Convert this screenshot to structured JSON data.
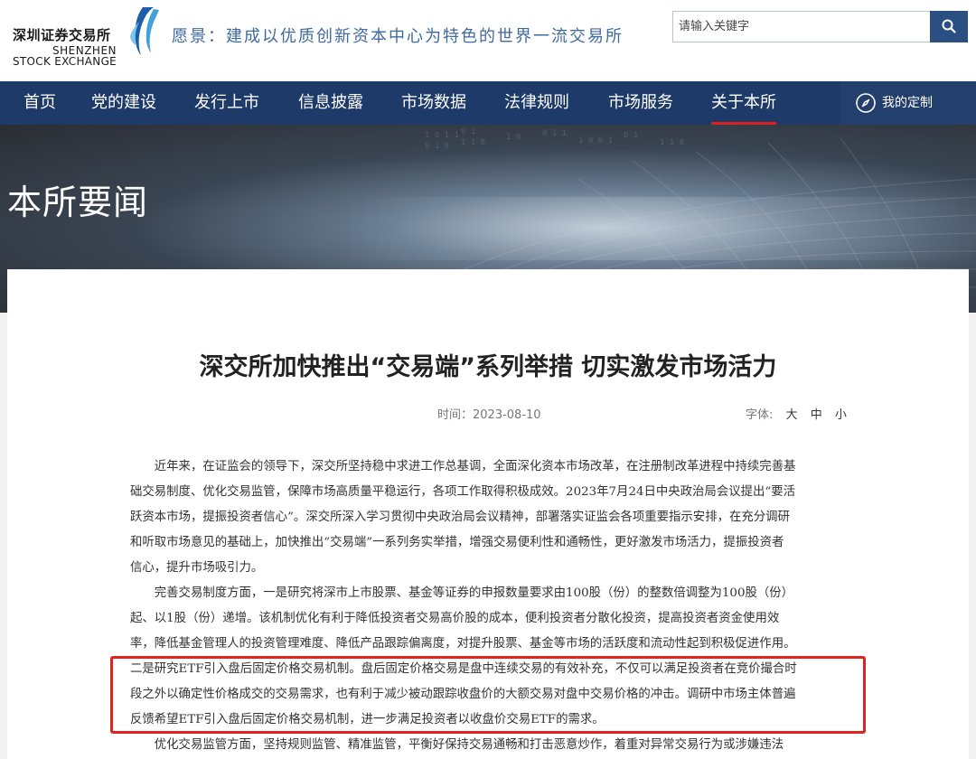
{
  "header": {
    "logo": {
      "name_cn": "深圳证券交易所",
      "name_en_line1": "SHENZHEN",
      "name_en_line2": "STOCK EXCHANGE"
    },
    "vision": "愿景：建成以优质创新资本中心为特色的世界一流交易所",
    "search": {
      "placeholder": "请输入关键字",
      "icon": "search-icon"
    }
  },
  "nav": {
    "items": [
      {
        "label": "首页",
        "active": false
      },
      {
        "label": "党的建设",
        "active": false
      },
      {
        "label": "发行上市",
        "active": false
      },
      {
        "label": "信息披露",
        "active": false
      },
      {
        "label": "市场数据",
        "active": false
      },
      {
        "label": "法律规则",
        "active": false
      },
      {
        "label": "市场服务",
        "active": false
      },
      {
        "label": "关于本所",
        "active": true
      }
    ],
    "custom": {
      "label": "我的定制",
      "icon": "compass-icon"
    }
  },
  "banner": {
    "title": "本所要闻"
  },
  "article": {
    "title": "深交所加快推出“交易端”系列举措 切实激发市场活力",
    "time_label": "时间：",
    "time_value": "2023-08-10",
    "font_label": "字体:",
    "font_sizes": [
      "大",
      "中",
      "小"
    ],
    "lines": [
      "　　近年来，在证监会的领导下，深交所坚持稳中求进工作总基调，全面深化资本市场改革，在注册制改革进程中持续完善基",
      "础交易制度、优化交易监管，保障市场高质量平稳运行，各项工作取得积极成效。2023年7月24日中央政治局会议提出“要活",
      "跃资本市场，提振投资者信心”。深交所深入学习贯彻中央政治局会议精神，部署落实证监会各项重要指示安排，在充分调研",
      "和听取市场意见的基础上，加快推出“交易端”一系列务实举措，增强交易便利性和通畅性，更好激发市场活力，提振投资者",
      "信心，提升市场吸引力。",
      "　　完善交易制度方面，一是研究将深市上市股票、基金等证券的申报数量要求由100股（份）的整数倍调整为100股（份）",
      "起、以1股（份）递增。该机制优化有利于降低投资者交易高价股的成本，便利投资者分散化投资，提高投资者资金使用效",
      "率，降低基金管理人的投资管理难度、降低产品跟踪偏离度，对提升股票、基金等市场的活跃度和流动性起到积极促进作用。",
      "二是研究ETF引入盘后固定价格交易机制。盘后固定价格交易是盘中连续交易的有效补充，不仅可以满足投资者在竞价撮合时",
      "段之外以确定性价格成交的交易需求，也有利于减少被动跟踪收盘价的大额交易对盘中交易价格的冲击。调研中市场主体普遍",
      "反馈希望ETF引入盘后固定价格交易机制，进一步满足投资者以收盘价交易ETF的需求。",
      "　　优化交易监管方面，坚持规则监管、精准监管，平衡好保持交易通畅和打击恶意炒作，着重对异常交易行为或涉嫌违法"
    ]
  },
  "colors": {
    "nav_bg": "#1d3a68",
    "active_underline": "#e02020",
    "search_button": "#2a4f83",
    "vision_text": "#3f6a9f",
    "highlight_box": "#e0231f"
  }
}
